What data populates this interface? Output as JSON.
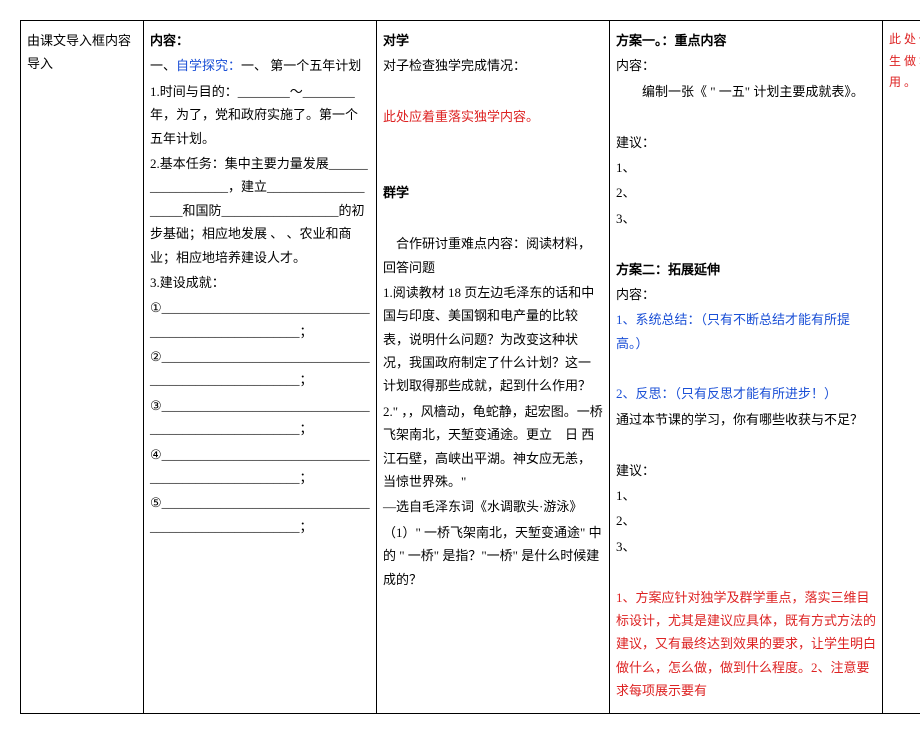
{
  "col1": {
    "title": "由课文导入框内容导入"
  },
  "col2": {
    "heading": "内容：",
    "line1a": "一、",
    "line1b": "自学探究：",
    "line1c": "一、 第一个五年计划",
    "item1_label": "1.时间与目的：________～________年，为了，党和政府实施了。第一个五年计划。",
    "item2_label": "2.基本任务：集中主要力量发展__________________，建立____________________和国防__________________的初步基础；相应地发展 、 、农业和商业；相应地培养建设人才。",
    "item3_label": "3.建设成就：",
    "ach1": "①_______________________________________________________；",
    "ach2": "②_______________________________________________________；",
    "ach3": "③_______________________________________________________；",
    "ach4": "④_______________________________________________________；",
    "ach5": "⑤_______________________________________________________；"
  },
  "col3": {
    "dx_heading": "对学",
    "dx_line1": "对子检查独学完成情况：",
    "dx_line2": "此处应着重落实独学内容。",
    "qx_heading": "群学",
    "qx_intro": "　合作研讨重难点内容：阅读材料，回答问题",
    "qx_1": "1.阅读教材 18 页左边毛泽东的话和中国与印度、美国钢和电产量的比较表，说明什么问题？为改变这种状况，我国政府制定了什么计划？这一计划取得那些成就，起到什么作用？",
    "qx_2": "2.\" ，，风樯动，龟蛇静，起宏图。一桥飞架南北，天堑变通途。更立　日 西江石壁，高峡出平湖。神女应无恙，当惊世界殊。\"",
    "qx_3": "—选自毛泽东词《水调歌头·游泳》",
    "qx_4": "（1）\" 一桥飞架南北，天堑变通途\" 中的 \" 一桥\" 是指？\"一桥\" 是什么时候建成的？"
  },
  "col4": {
    "plan1_heading": "方案一。：重点内容",
    "plan1_content_label": "内容：",
    "plan1_content": "　　编制一张《 \" 一五\" 计划主要成就表》。",
    "suggest_label": "建议：",
    "s1": "1、",
    "s2": "2、",
    "s3": "3、",
    "plan2_heading": "方案二：拓展延伸",
    "plan2_content_label": "内容：",
    "plan2_line1": "1、系统总结：（只有不断总结才能有所提高。）",
    "plan2_line2": "2、反思：（只有反思才能有所进步！）",
    "plan2_line3": "通过本节课的学习，你有哪些收获与不足？",
    "suggest_label2": "建议：",
    "s1b": "1、",
    "s2b": "2、",
    "s3b": "3、",
    "note": "1、方案应针对独学及群学重点，落实三维目标设计，尤其是建议应具体，既有方式方法的建议，又有最终达到效果的要求，让学生明白做什么，怎么做，做到什么程度。2、注意要求每项展示要有"
  },
  "col5": {
    "note": "此 处 供 学 生 做 笔 记 用 。"
  }
}
